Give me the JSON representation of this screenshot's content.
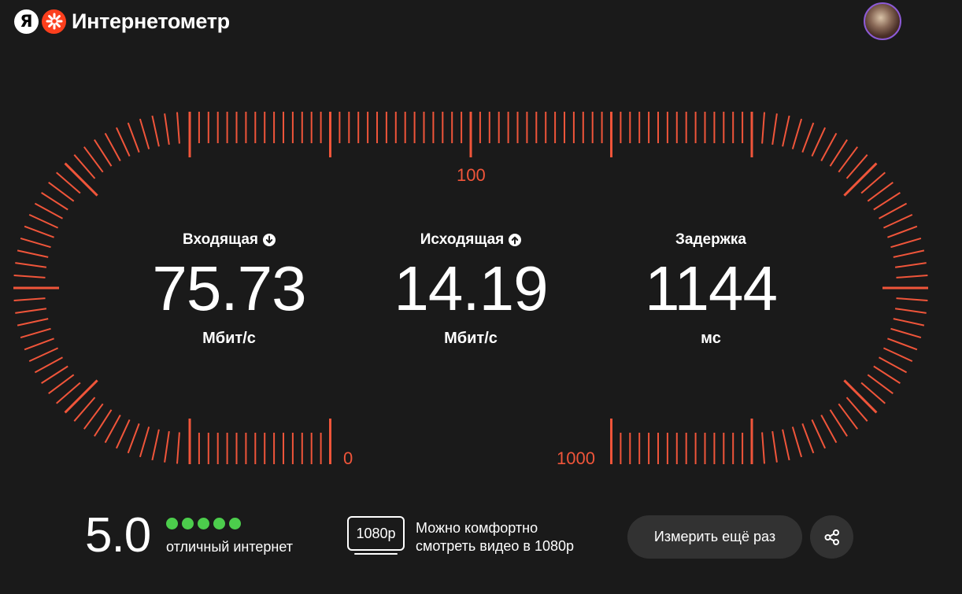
{
  "header": {
    "logo_letter": "Я",
    "title": "Интернетометр"
  },
  "gauge": {
    "scale_labels": {
      "top": "100",
      "bottom_left": "0",
      "bottom_right": "1000"
    },
    "tick_color": "#f0553a"
  },
  "metrics": {
    "download": {
      "label": "Входящая",
      "value": "75.73",
      "unit": "Мбит/с"
    },
    "upload": {
      "label": "Исходящая",
      "value": "14.19",
      "unit": "Мбит/с"
    },
    "latency": {
      "label": "Задержка",
      "value": "1144",
      "unit": "мс"
    }
  },
  "rating": {
    "score": "5.0",
    "stars_filled": 5,
    "stars_total": 5,
    "text": "отличный интернет",
    "dot_color": "#4ccd4c"
  },
  "video": {
    "badge": "1080p",
    "line1": "Можно комфортно",
    "line2": "смотреть видео в 1080p"
  },
  "actions": {
    "retry_label": "Измерить ещё раз"
  },
  "colors": {
    "background": "#1a1a1a",
    "accent": "#fc3f1d",
    "button_bg": "#323232"
  }
}
